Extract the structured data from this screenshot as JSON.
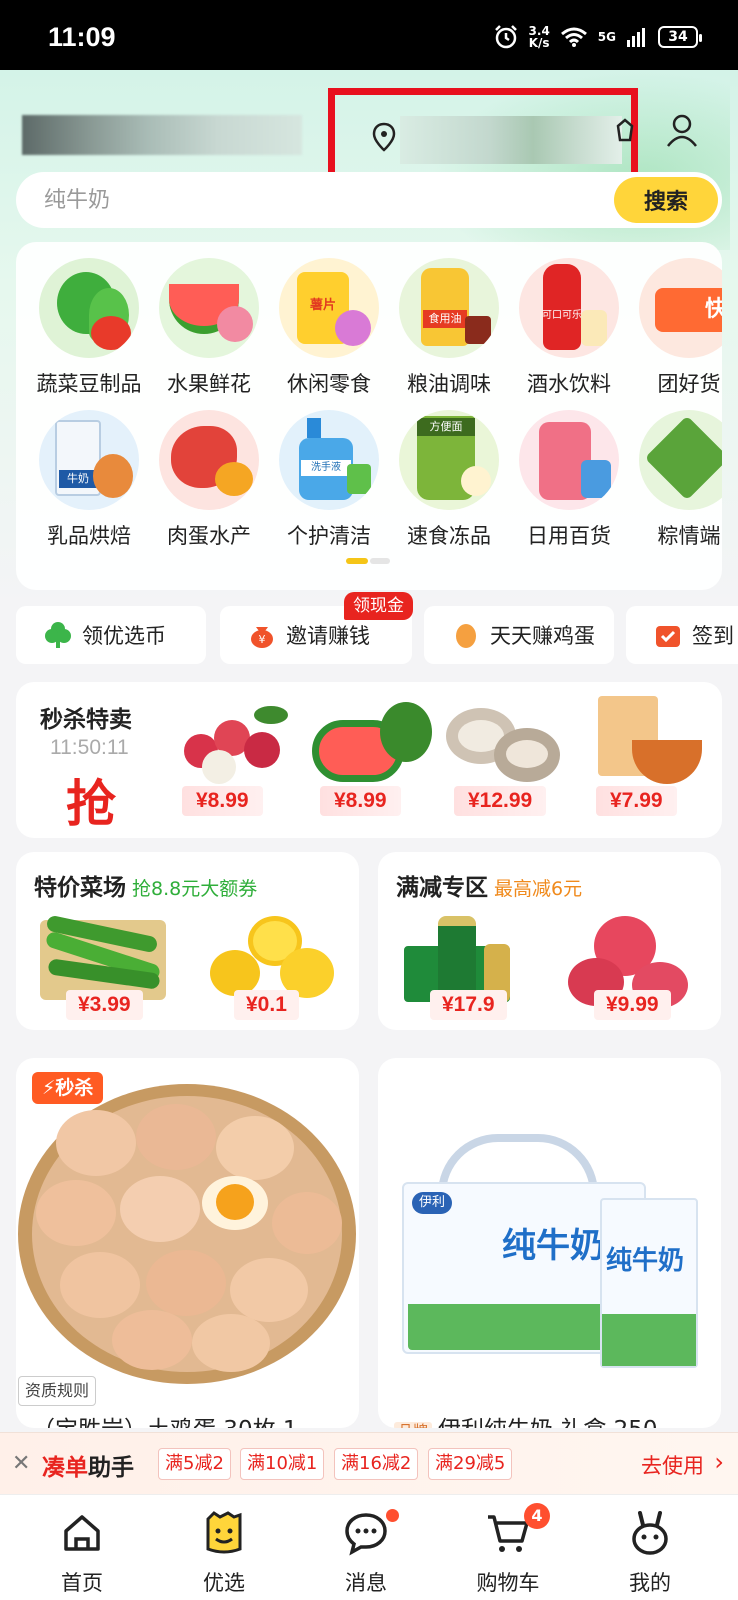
{
  "status_bar": {
    "time": "11:09",
    "net_speed": "3.4",
    "net_unit": "K/s",
    "network": "5G",
    "battery": "34"
  },
  "header": {
    "search_placeholder": "纯牛奶",
    "search_button": "搜索"
  },
  "categories": [
    {
      "label": "蔬菜豆制品",
      "icon": "vegetable-icon"
    },
    {
      "label": "水果鲜花",
      "icon": "watermelon-icon"
    },
    {
      "label": "休闲零食",
      "icon": "snack-icon"
    },
    {
      "label": "粮油调味",
      "icon": "oil-icon"
    },
    {
      "label": "酒水饮料",
      "icon": "cola-icon"
    },
    {
      "label": "团好货",
      "icon": "truck-icon"
    },
    {
      "label": "乳品烘焙",
      "icon": "milk-icon"
    },
    {
      "label": "肉蛋水产",
      "icon": "meat-icon"
    },
    {
      "label": "个护清洁",
      "icon": "handwash-icon"
    },
    {
      "label": "速食冻品",
      "icon": "instant-noodle-icon"
    },
    {
      "label": "日用百货",
      "icon": "thermos-icon"
    },
    {
      "label": "粽情端",
      "icon": "zongzi-icon"
    }
  ],
  "category_icon_texts": {
    "snack": "薯片",
    "oil": "食用油",
    "cola": "可口可乐",
    "truck": "快",
    "milk": "牛奶",
    "handwash": "洗手液",
    "noodle": "方便面"
  },
  "quick_links": [
    {
      "label": "领优选币",
      "icon": "clover-coin-icon"
    },
    {
      "label": "邀请赚钱",
      "icon": "money-bag-icon"
    },
    {
      "label": "天天赚鸡蛋",
      "icon": "egg-icon"
    },
    {
      "label": "签到",
      "icon": "calendar-check-icon"
    }
  ],
  "quick_badge": "领现金",
  "flash_sale": {
    "title": "秒杀特卖",
    "countdown": "11:50:11",
    "grab": "抢",
    "items": [
      {
        "price": "¥8.99",
        "icon": "lychee-icon"
      },
      {
        "price": "¥8.99",
        "icon": "watermelon-icon"
      },
      {
        "price": "¥12.99",
        "icon": "oyster-icon"
      },
      {
        "price": "¥7.99",
        "icon": "noodle-pack-icon"
      }
    ]
  },
  "promo_cards": [
    {
      "title": "特价菜场",
      "subtitle": "抢8.8元大额券",
      "subtitle_color": "#2fae3a",
      "items": [
        {
          "price": "¥3.99",
          "icon": "peas-icon"
        },
        {
          "price": "¥0.1",
          "icon": "lemon-icon"
        }
      ]
    },
    {
      "title": "满减专区",
      "subtitle": "最高减6元",
      "subtitle_color": "#f08a1c",
      "items": [
        {
          "price": "¥17.9",
          "icon": "beer-icon"
        },
        {
          "price": "¥9.99",
          "icon": "lychee-icon"
        }
      ]
    }
  ],
  "feed": [
    {
      "badge": "秒杀",
      "qualification": "资质规则",
      "title": "（宝胜岩）土鸡蛋 30枚 1",
      "icon": "egg-basket-icon"
    },
    {
      "brand": "品牌",
      "title": "伊利纯牛奶 礼盒 250",
      "box_logo": "伊利",
      "box_text": "纯牛奶",
      "icon": "milk-box-icon"
    }
  ],
  "assistant_bar": {
    "title_red": "凑单",
    "title_black": "助手",
    "chips": [
      "满5减2",
      "满10减1",
      "满16减2",
      "满29减5"
    ],
    "go": "去使用"
  },
  "bottom_nav": [
    {
      "label": "首页",
      "icon": "home-icon"
    },
    {
      "label": "优选",
      "icon": "youxuan-icon"
    },
    {
      "label": "消息",
      "icon": "message-icon"
    },
    {
      "label": "购物车",
      "icon": "cart-icon",
      "badge": "4"
    },
    {
      "label": "我的",
      "icon": "profile-icon"
    }
  ],
  "colors": {
    "accent_red": "#e8241f",
    "search_button": "#ffd53a",
    "header_green": "#d4f3e8"
  }
}
